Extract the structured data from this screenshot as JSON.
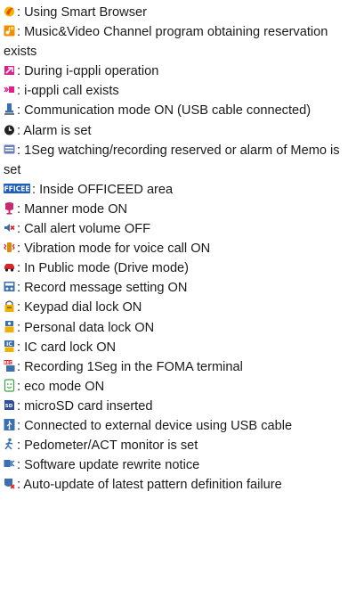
{
  "entries": [
    {
      "icon": "smart-browser-icon",
      "text": ": Using Smart Browser"
    },
    {
      "icon": "music-video-channel-icon",
      "text": ": Music&Video Channel program obtaining reservation exists"
    },
    {
      "icon": "iappli-operation-icon",
      "text": ": During i-αppli operation"
    },
    {
      "icon": "iappli-call-icon",
      "text": ": i-αppli call exists"
    },
    {
      "icon": "usb-communication-icon",
      "text": ": Communication mode ON (USB cable connected)"
    },
    {
      "icon": "alarm-icon",
      "text": ": Alarm is set"
    },
    {
      "icon": "1seg-reserved-icon",
      "text": ": 1Seg watching/recording reserved or alarm of Memo is set"
    },
    {
      "icon": "officeed-icon",
      "text": ": Inside OFFICEED area"
    },
    {
      "icon": "manner-mode-icon",
      "text": ": Manner mode ON"
    },
    {
      "icon": "call-alert-off-icon",
      "text": ": Call alert volume OFF"
    },
    {
      "icon": "vibration-icon",
      "text": ": Vibration mode for voice call ON"
    },
    {
      "icon": "public-mode-car-icon",
      "text": ": In Public mode (Drive mode)"
    },
    {
      "icon": "record-message-icon",
      "text": ": Record message setting ON"
    },
    {
      "icon": "keypad-dial-lock-icon",
      "text": ": Keypad dial lock ON"
    },
    {
      "icon": "personal-data-lock-icon",
      "text": ": Personal data lock ON"
    },
    {
      "icon": "ic-card-lock-icon",
      "text": ": IC card lock ON"
    },
    {
      "icon": "rec-1seg-icon",
      "text": ": Recording 1Seg in the FOMA terminal"
    },
    {
      "icon": "eco-mode-icon",
      "text": ": eco mode ON"
    },
    {
      "icon": "microsd-icon",
      "text": ": microSD card inserted"
    },
    {
      "icon": "usb-external-device-icon",
      "text": ": Connected to external device using USB cable"
    },
    {
      "icon": "pedometer-icon",
      "text": ": Pedometer/ACT monitor is set"
    },
    {
      "icon": "software-update-icon",
      "text": ": Software update rewrite notice"
    },
    {
      "icon": "pattern-update-failure-icon",
      "text": ": Auto-update of latest pattern definition failure"
    }
  ]
}
